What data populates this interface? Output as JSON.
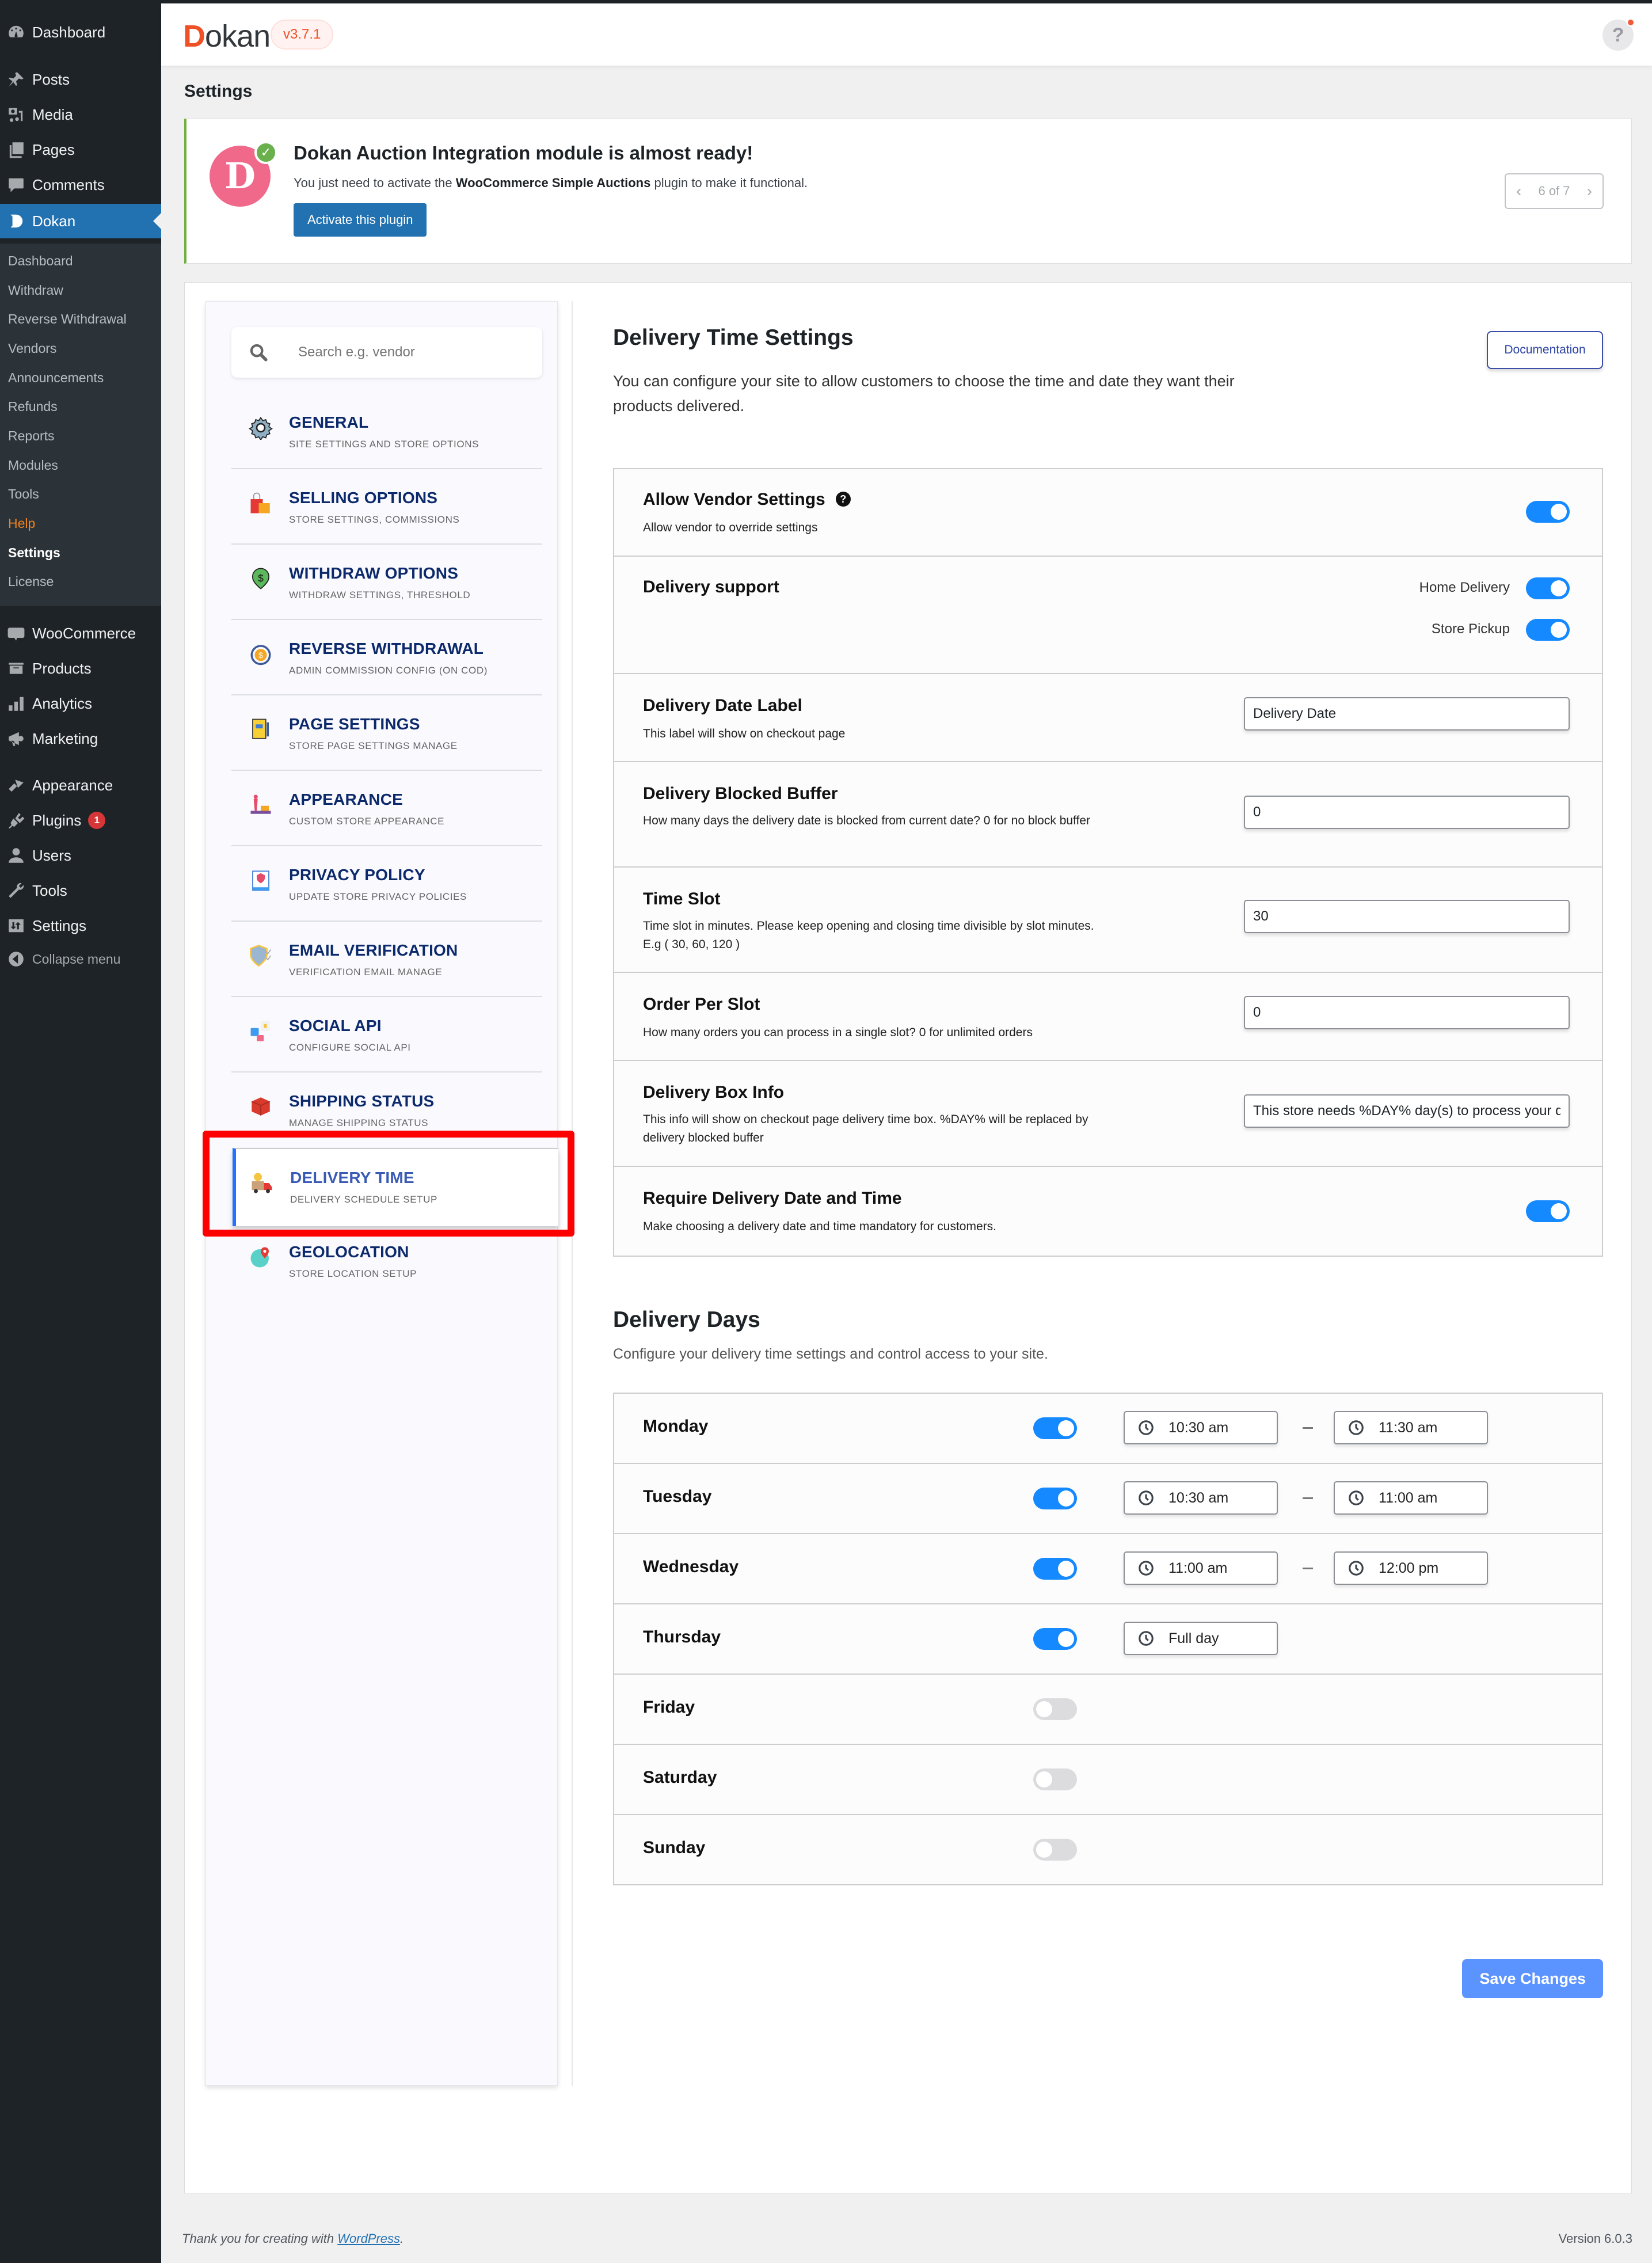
{
  "wp_menu": {
    "top_items": [
      {
        "label": "Dashboard",
        "icon": "dashboard-icon"
      },
      {
        "label": "Posts",
        "icon": "pin-icon"
      },
      {
        "label": "Media",
        "icon": "media-icon"
      },
      {
        "label": "Pages",
        "icon": "pages-icon"
      },
      {
        "label": "Comments",
        "icon": "comments-icon"
      },
      {
        "label": "Dokan",
        "icon": "dokan-icon",
        "active": true
      }
    ],
    "dokan_submenu": [
      {
        "label": "Dashboard"
      },
      {
        "label": "Withdraw"
      },
      {
        "label": "Reverse Withdrawal"
      },
      {
        "label": "Vendors"
      },
      {
        "label": "Announcements"
      },
      {
        "label": "Refunds"
      },
      {
        "label": "Reports"
      },
      {
        "label": "Modules"
      },
      {
        "label": "Tools"
      },
      {
        "label": "Help",
        "highlight": "orange"
      },
      {
        "label": "Settings",
        "current": true
      },
      {
        "label": "License"
      }
    ],
    "bottom_items": [
      {
        "label": "WooCommerce",
        "icon": "woo-icon"
      },
      {
        "label": "Products",
        "icon": "products-icon"
      },
      {
        "label": "Analytics",
        "icon": "analytics-icon"
      },
      {
        "label": "Marketing",
        "icon": "megaphone-icon"
      },
      {
        "label": "Appearance",
        "icon": "brush-icon"
      },
      {
        "label": "Plugins",
        "icon": "plugin-icon",
        "badge": "1"
      },
      {
        "label": "Users",
        "icon": "user-icon"
      },
      {
        "label": "Tools",
        "icon": "wrench-icon"
      },
      {
        "label": "Settings",
        "icon": "settings-icon"
      },
      {
        "label": "Collapse menu",
        "icon": "collapse-icon"
      }
    ]
  },
  "header": {
    "logo_initial": "D",
    "logo_rest": "okan",
    "version": "v3.7.1",
    "help_label": "?"
  },
  "page_title": "Settings",
  "notice": {
    "logo_letter": "D",
    "title": "Dokan Auction Integration module is almost ready!",
    "text_before": "You just need to activate the ",
    "text_bold": "WooCommerce Simple Auctions",
    "text_after": " plugin to make it functional.",
    "button": "Activate this plugin",
    "pager": "6 of 7",
    "prev": "‹",
    "next": "›"
  },
  "settings_nav": {
    "search_placeholder": "Search e.g. vendor",
    "items": [
      {
        "title": "GENERAL",
        "subtitle": "SITE SETTINGS AND STORE OPTIONS",
        "icon": "gear-icon"
      },
      {
        "title": "SELLING OPTIONS",
        "subtitle": "STORE SETTINGS, COMMISSIONS",
        "icon": "shopping-bag-icon"
      },
      {
        "title": "WITHDRAW OPTIONS",
        "subtitle": "WITHDRAW SETTINGS, THRESHOLD",
        "icon": "money-leaf-icon"
      },
      {
        "title": "REVERSE WITHDRAWAL",
        "subtitle": "ADMIN COMMISSION CONFIG (ON COD)",
        "icon": "coin-refresh-icon"
      },
      {
        "title": "PAGE SETTINGS",
        "subtitle": "STORE PAGE SETTINGS MANAGE",
        "icon": "page-icon"
      },
      {
        "title": "APPEARANCE",
        "subtitle": "CUSTOM STORE APPEARANCE",
        "icon": "store-display-icon"
      },
      {
        "title": "PRIVACY POLICY",
        "subtitle": "UPDATE STORE PRIVACY POLICIES",
        "icon": "privacy-clipboard-icon"
      },
      {
        "title": "EMAIL VERIFICATION",
        "subtitle": "VERIFICATION EMAIL MANAGE",
        "icon": "shield-check-icon"
      },
      {
        "title": "SOCIAL API",
        "subtitle": "CONFIGURE SOCIAL API",
        "icon": "social-bubbles-icon"
      },
      {
        "title": "SHIPPING STATUS",
        "subtitle": "MANAGE SHIPPING STATUS",
        "icon": "container-icon"
      },
      {
        "title": "DELIVERY TIME",
        "subtitle": "DELIVERY SCHEDULE SETUP",
        "icon": "delivery-truck-icon",
        "active": true
      },
      {
        "title": "GEOLOCATION",
        "subtitle": "STORE LOCATION SETUP",
        "icon": "globe-pin-icon"
      }
    ]
  },
  "delivery_settings": {
    "title": "Delivery Time Settings",
    "description": "You can configure your site to allow customers to choose the time and date they want their products delivered.",
    "doc_button": "Documentation",
    "fields": {
      "allow_vendor": {
        "title": "Allow Vendor Settings",
        "desc": "Allow vendor to override settings",
        "enabled": true
      },
      "delivery_support": {
        "title": "Delivery support",
        "home_delivery_label": "Home Delivery",
        "home_delivery": true,
        "store_pickup_label": "Store Pickup",
        "store_pickup": true
      },
      "date_label": {
        "title": "Delivery Date Label",
        "desc": "This label will show on checkout page",
        "value": "Delivery Date"
      },
      "blocked_buffer": {
        "title": "Delivery Blocked Buffer",
        "desc": "How many days the delivery date is blocked from current date? 0 for no block buffer",
        "value": "0"
      },
      "time_slot": {
        "title": "Time Slot",
        "desc": "Time slot in minutes. Please keep opening and closing time divisible by slot minutes. E.g ( 30, 60, 120 )",
        "value": "30"
      },
      "order_per_slot": {
        "title": "Order Per Slot",
        "desc": "How many orders you can process in a single slot? 0 for unlimited orders",
        "value": "0"
      },
      "box_info": {
        "title": "Delivery Box Info",
        "desc": "This info will show on checkout page delivery time box. %DAY% will be replaced by delivery blocked buffer",
        "value": "This store needs %DAY% day(s) to process your delivery request"
      },
      "require_date_time": {
        "title": "Require Delivery Date and Time",
        "desc": "Make choosing a delivery date and time mandatory for customers.",
        "enabled": true
      }
    }
  },
  "delivery_days": {
    "title": "Delivery Days",
    "description": "Configure your delivery time settings and control access to your site.",
    "days": [
      {
        "name": "Monday",
        "enabled": true,
        "from": "10:30 am",
        "to": "11:30 am"
      },
      {
        "name": "Tuesday",
        "enabled": true,
        "from": "10:30 am",
        "to": "11:00 am"
      },
      {
        "name": "Wednesday",
        "enabled": true,
        "from": "11:00 am",
        "to": "12:00 pm"
      },
      {
        "name": "Thursday",
        "enabled": true,
        "from": "Full day",
        "to": null
      },
      {
        "name": "Friday",
        "enabled": false,
        "from": null,
        "to": null
      },
      {
        "name": "Saturday",
        "enabled": false,
        "from": null,
        "to": null
      },
      {
        "name": "Sunday",
        "enabled": false,
        "from": null,
        "to": null
      }
    ]
  },
  "save_button": "Save Changes",
  "footer": {
    "thanks": "Thank you for creating with ",
    "link": "WordPress",
    "period": ".",
    "version": "Version 6.0.3"
  },
  "colors": {
    "wp_dark": "#1d2327",
    "wp_blue": "#2271b1",
    "toggle_on": "#1589ff",
    "save_btn": "#5b93ff",
    "nav_title": "#0c2a6b",
    "dokan_brand": "#f05025",
    "highlight_red": "#ff0000"
  }
}
